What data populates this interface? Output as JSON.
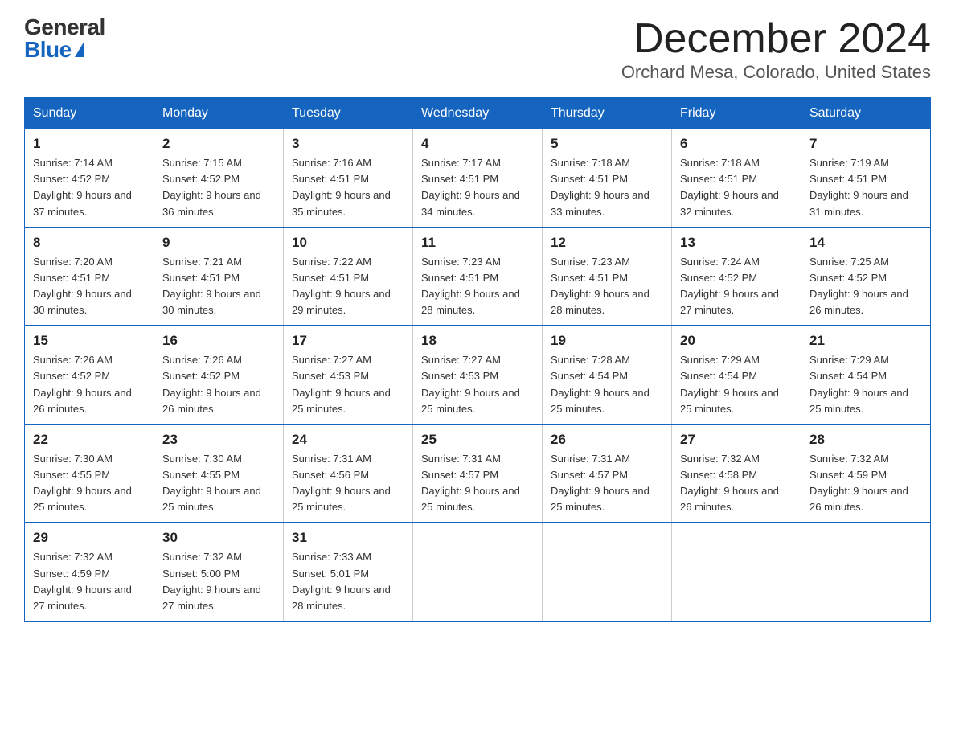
{
  "logo": {
    "general": "General",
    "blue": "Blue"
  },
  "title": "December 2024",
  "location": "Orchard Mesa, Colorado, United States",
  "weekdays": [
    "Sunday",
    "Monday",
    "Tuesday",
    "Wednesday",
    "Thursday",
    "Friday",
    "Saturday"
  ],
  "weeks": [
    [
      {
        "day": "1",
        "sunrise": "7:14 AM",
        "sunset": "4:52 PM",
        "daylight": "9 hours and 37 minutes."
      },
      {
        "day": "2",
        "sunrise": "7:15 AM",
        "sunset": "4:52 PM",
        "daylight": "9 hours and 36 minutes."
      },
      {
        "day": "3",
        "sunrise": "7:16 AM",
        "sunset": "4:51 PM",
        "daylight": "9 hours and 35 minutes."
      },
      {
        "day": "4",
        "sunrise": "7:17 AM",
        "sunset": "4:51 PM",
        "daylight": "9 hours and 34 minutes."
      },
      {
        "day": "5",
        "sunrise": "7:18 AM",
        "sunset": "4:51 PM",
        "daylight": "9 hours and 33 minutes."
      },
      {
        "day": "6",
        "sunrise": "7:18 AM",
        "sunset": "4:51 PM",
        "daylight": "9 hours and 32 minutes."
      },
      {
        "day": "7",
        "sunrise": "7:19 AM",
        "sunset": "4:51 PM",
        "daylight": "9 hours and 31 minutes."
      }
    ],
    [
      {
        "day": "8",
        "sunrise": "7:20 AM",
        "sunset": "4:51 PM",
        "daylight": "9 hours and 30 minutes."
      },
      {
        "day": "9",
        "sunrise": "7:21 AM",
        "sunset": "4:51 PM",
        "daylight": "9 hours and 30 minutes."
      },
      {
        "day": "10",
        "sunrise": "7:22 AM",
        "sunset": "4:51 PM",
        "daylight": "9 hours and 29 minutes."
      },
      {
        "day": "11",
        "sunrise": "7:23 AM",
        "sunset": "4:51 PM",
        "daylight": "9 hours and 28 minutes."
      },
      {
        "day": "12",
        "sunrise": "7:23 AM",
        "sunset": "4:51 PM",
        "daylight": "9 hours and 28 minutes."
      },
      {
        "day": "13",
        "sunrise": "7:24 AM",
        "sunset": "4:52 PM",
        "daylight": "9 hours and 27 minutes."
      },
      {
        "day": "14",
        "sunrise": "7:25 AM",
        "sunset": "4:52 PM",
        "daylight": "9 hours and 26 minutes."
      }
    ],
    [
      {
        "day": "15",
        "sunrise": "7:26 AM",
        "sunset": "4:52 PM",
        "daylight": "9 hours and 26 minutes."
      },
      {
        "day": "16",
        "sunrise": "7:26 AM",
        "sunset": "4:52 PM",
        "daylight": "9 hours and 26 minutes."
      },
      {
        "day": "17",
        "sunrise": "7:27 AM",
        "sunset": "4:53 PM",
        "daylight": "9 hours and 25 minutes."
      },
      {
        "day": "18",
        "sunrise": "7:27 AM",
        "sunset": "4:53 PM",
        "daylight": "9 hours and 25 minutes."
      },
      {
        "day": "19",
        "sunrise": "7:28 AM",
        "sunset": "4:54 PM",
        "daylight": "9 hours and 25 minutes."
      },
      {
        "day": "20",
        "sunrise": "7:29 AM",
        "sunset": "4:54 PM",
        "daylight": "9 hours and 25 minutes."
      },
      {
        "day": "21",
        "sunrise": "7:29 AM",
        "sunset": "4:54 PM",
        "daylight": "9 hours and 25 minutes."
      }
    ],
    [
      {
        "day": "22",
        "sunrise": "7:30 AM",
        "sunset": "4:55 PM",
        "daylight": "9 hours and 25 minutes."
      },
      {
        "day": "23",
        "sunrise": "7:30 AM",
        "sunset": "4:55 PM",
        "daylight": "9 hours and 25 minutes."
      },
      {
        "day": "24",
        "sunrise": "7:31 AM",
        "sunset": "4:56 PM",
        "daylight": "9 hours and 25 minutes."
      },
      {
        "day": "25",
        "sunrise": "7:31 AM",
        "sunset": "4:57 PM",
        "daylight": "9 hours and 25 minutes."
      },
      {
        "day": "26",
        "sunrise": "7:31 AM",
        "sunset": "4:57 PM",
        "daylight": "9 hours and 25 minutes."
      },
      {
        "day": "27",
        "sunrise": "7:32 AM",
        "sunset": "4:58 PM",
        "daylight": "9 hours and 26 minutes."
      },
      {
        "day": "28",
        "sunrise": "7:32 AM",
        "sunset": "4:59 PM",
        "daylight": "9 hours and 26 minutes."
      }
    ],
    [
      {
        "day": "29",
        "sunrise": "7:32 AM",
        "sunset": "4:59 PM",
        "daylight": "9 hours and 27 minutes."
      },
      {
        "day": "30",
        "sunrise": "7:32 AM",
        "sunset": "5:00 PM",
        "daylight": "9 hours and 27 minutes."
      },
      {
        "day": "31",
        "sunrise": "7:33 AM",
        "sunset": "5:01 PM",
        "daylight": "9 hours and 28 minutes."
      },
      null,
      null,
      null,
      null
    ]
  ]
}
